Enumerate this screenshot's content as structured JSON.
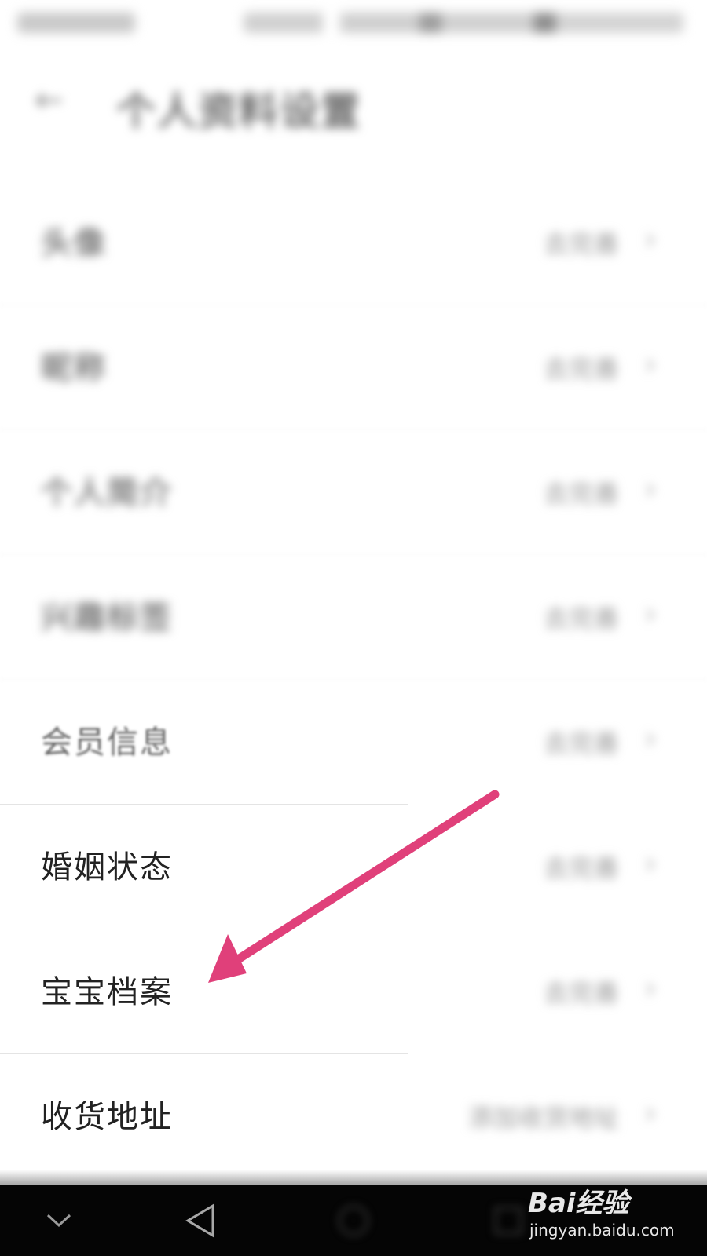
{
  "status_bar": {
    "carrier": "",
    "indicators": ""
  },
  "header": {
    "back_icon": "arrow-left-icon",
    "title": "个人资料设置"
  },
  "settings": [
    {
      "label": "头像",
      "value": "去完善",
      "chevron": "›",
      "state": "blurred"
    },
    {
      "label": "昵称",
      "value": "去完善",
      "chevron": "›",
      "state": "blurred"
    },
    {
      "label": "个人简介",
      "value": "去完善",
      "chevron": "›",
      "state": "blurred"
    },
    {
      "label": "兴趣标签",
      "value": "去完善",
      "chevron": "›",
      "state": "blurred"
    },
    {
      "label": "会员信息",
      "value": "去完善",
      "chevron": "›",
      "state": "soft"
    },
    {
      "label": "婚姻状态",
      "value": "去完善",
      "chevron": "›",
      "state": "sharp"
    },
    {
      "label": "宝宝档案",
      "value": "去完善",
      "chevron": "›",
      "state": "sharp"
    },
    {
      "label": "收货地址",
      "value": "添加收货地址",
      "chevron": "›",
      "state": "sharp"
    }
  ],
  "annotation": {
    "color": "#e0407a",
    "target": "宝宝档案"
  },
  "nav_bar": {
    "icons": [
      "chevron-down-icon",
      "back-triangle-icon",
      "home-circle-icon",
      "recents-square-icon"
    ]
  },
  "watermark": {
    "brand": "Bai经验",
    "url": "jingyan.baidu.com"
  },
  "colors": {
    "accent_arrow": "#e0407a",
    "nav_background": "#050505",
    "text_primary": "#222222"
  }
}
